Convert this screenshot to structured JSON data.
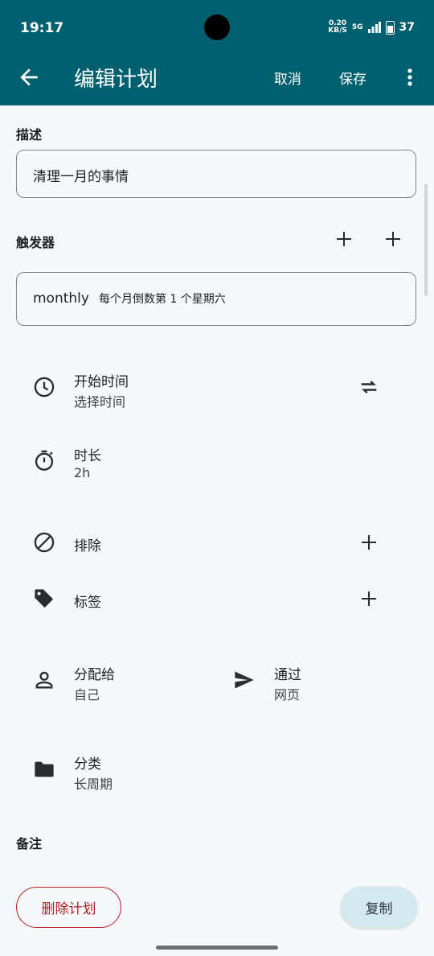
{
  "colors": {
    "appbar": "#00606f",
    "danger": "#b81d1d",
    "copy_bg": "#d3e8ef"
  },
  "status": {
    "time": "19:17",
    "net_speed": "0.20",
    "net_unit": "KB/S",
    "signal": "5G",
    "battery": "37"
  },
  "header": {
    "title": "编辑计划",
    "cancel_label": "取消",
    "save_label": "保存",
    "back_icon": "arrow-left-icon",
    "more_icon": "more-vertical-icon"
  },
  "description": {
    "label": "描述",
    "value": "清理一月的事情"
  },
  "trigger": {
    "label": "触发器",
    "name": "monthly",
    "detail": "每个月倒数第 1 个星期六"
  },
  "start_time": {
    "title": "开始时间",
    "value": "选择时间",
    "icon": "clock-icon",
    "action_icon": "swap-icon"
  },
  "duration": {
    "title": "时长",
    "value": "2h",
    "icon": "timer-icon"
  },
  "exclude": {
    "title": "排除",
    "icon": "block-icon"
  },
  "tags": {
    "title": "标签",
    "icon": "tag-icon"
  },
  "assign": {
    "title": "分配给",
    "value": "自己",
    "icon": "person-icon"
  },
  "via": {
    "title": "通过",
    "value": "网页",
    "icon": "send-icon"
  },
  "category": {
    "title": "分类",
    "value": "长周期",
    "icon": "folder-icon"
  },
  "notes": {
    "label": "备注"
  },
  "actions": {
    "delete_label": "删除计划",
    "copy_label": "复制"
  }
}
